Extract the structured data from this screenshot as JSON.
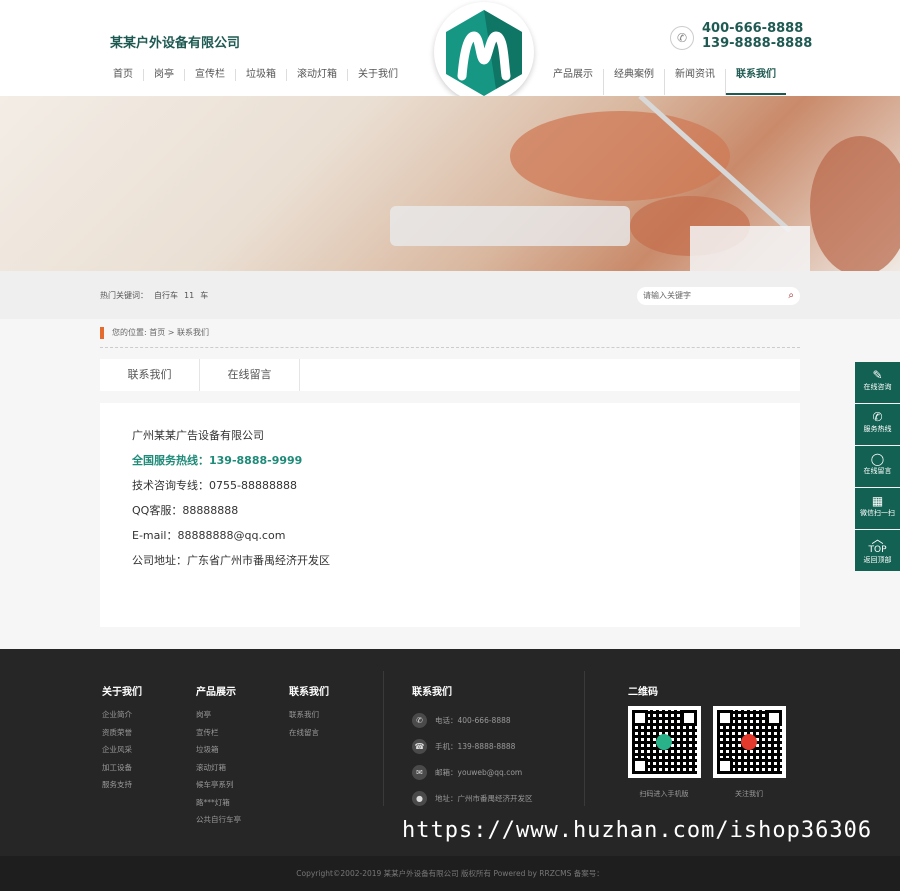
{
  "header": {
    "company": "某某户外设备有限公司",
    "nav_left": [
      "首页",
      "岗亭",
      "宣传栏",
      "垃圾箱",
      "滚动灯箱",
      "关于我们"
    ],
    "nav_right": [
      "产品展示",
      "经典案例",
      "新闻资讯",
      "联系我们"
    ],
    "phone1": "400-666-8888",
    "phone2": "139-8888-8888"
  },
  "search": {
    "hot_label": "热门关键词：",
    "hot_words": [
      "自行车",
      "11",
      "车"
    ],
    "placeholder": "请输入关键字"
  },
  "breadcrumb": "您的位置: 首页 > 联系我们",
  "tabs": [
    "联系我们",
    "在线留言"
  ],
  "contact": {
    "company": "广州某某广告设备有限公司",
    "hotline": "全国服务热线：139-8888-9999",
    "tech": "技术咨询专线：0755-88888888",
    "qq": "QQ客服：88888888",
    "email": "E-mail：88888888@qq.com",
    "address": "公司地址：广东省广州市番禺经济开发区"
  },
  "sidebar": [
    {
      "label": "在线咨询",
      "icon": "chat-icon"
    },
    {
      "label": "服务热线",
      "icon": "phone-icon"
    },
    {
      "label": "在线留言",
      "icon": "message-icon"
    },
    {
      "label": "微信扫一扫",
      "icon": "qrcode-icon"
    },
    {
      "label": "TOP",
      "sub": "返回顶部",
      "icon": "up-arrow-icon"
    }
  ],
  "footer": {
    "about": {
      "title": "关于我们",
      "items": [
        "企业简介",
        "资质荣誉",
        "企业风采",
        "加工设备",
        "服务支持"
      ]
    },
    "products": {
      "title": "产品展示",
      "items": [
        "岗亭",
        "宣传栏",
        "垃圾箱",
        "滚动灯箱",
        "候车亭系列",
        "路***灯箱",
        "公共自行车亭"
      ]
    },
    "contactus": {
      "title": "联系我们",
      "items": [
        "联系我们",
        "在线留言"
      ]
    },
    "contact_info": {
      "title": "联系我们",
      "rows": [
        "电话：400-666-8888",
        "手机：139-8888-8888",
        "邮箱：youweb@qq.com",
        "地址：广州市番禺经济开发区"
      ]
    },
    "qr": {
      "title": "二维码",
      "labels": [
        "扫码进入手机版",
        "关注我们"
      ]
    }
  },
  "watermark": "https://www.huzhan.com/ishop36306",
  "copyright": "Copyright©2002-2019 某某户外设备有限公司 版权所有 Powered by RRZCMS    备案号："
}
